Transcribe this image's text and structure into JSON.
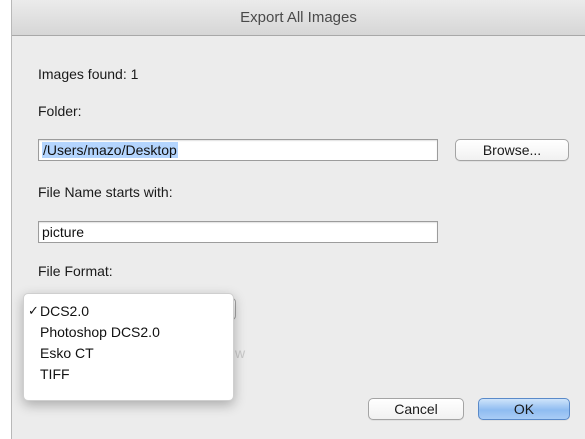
{
  "dialog": {
    "title": "Export All Images",
    "images_found": "Images found: 1",
    "folder_label": "Folder:",
    "folder_value": "/Users/mazo/Desktop",
    "browse_label": "Browse...",
    "filename_label": "File Name starts with:",
    "filename_value": "picture",
    "format_label": "File Format:",
    "cancel_label": "Cancel",
    "ok_label": "OK",
    "partially_hidden_label": "w"
  },
  "format_menu": {
    "selected": "DCS2.0",
    "check_glyph": "✓",
    "options": [
      "DCS2.0",
      "Photoshop DCS2.0",
      "Esko CT",
      "TIFF"
    ]
  },
  "colors": {
    "window_bg": "#ececec",
    "selection": "#b4d5fe",
    "default_button": "#8fbcf1"
  }
}
